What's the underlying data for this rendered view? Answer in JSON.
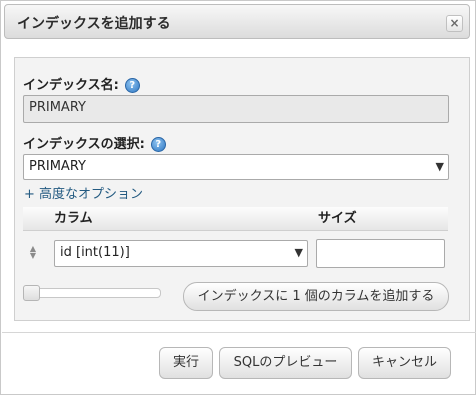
{
  "dialog": {
    "title": "インデックスを追加する",
    "close_glyph": "×"
  },
  "form": {
    "index_name_label": "インデックス名:",
    "index_name_value": "PRIMARY",
    "index_choice_label": "インデックスの選択:",
    "index_choice_selected": "PRIMARY",
    "advanced_options_link": "+ 高度なオプション",
    "help_glyph": "?"
  },
  "columns_table": {
    "headers": [
      "カラム",
      "サイズ"
    ],
    "rows": [
      {
        "column": "id [int(11)]",
        "size": ""
      }
    ]
  },
  "add_columns": {
    "button_label": "インデックスに 1 個のカラムを追加する",
    "count": 1
  },
  "footer": {
    "buttons": [
      "実行",
      "SQLのプレビュー",
      "キャンセル"
    ]
  },
  "icons": {
    "help": "help-icon",
    "close": "close-icon",
    "drag": "drag-handle-icon",
    "dropdown": "chevron-down-icon"
  },
  "colors": {
    "link": "#235a81",
    "help_icon": "#2f78c4"
  }
}
